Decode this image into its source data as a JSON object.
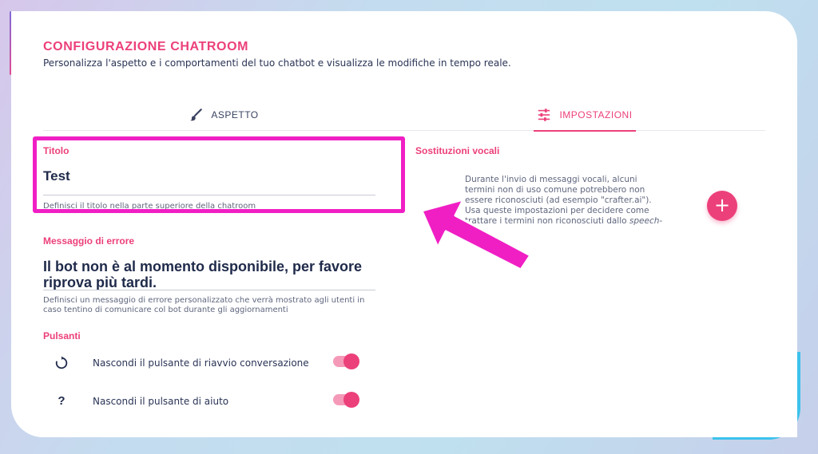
{
  "header": {
    "title": "CONFIGURAZIONE CHATROOM",
    "subtitle": "Personalizza l'aspetto e i comportamenti del tuo chatbot e visualizza le modifiche in tempo reale."
  },
  "tabs": [
    {
      "label": "ASPETTO",
      "icon": "brush-icon",
      "active": false
    },
    {
      "label": "IMPOSTAZIONI",
      "icon": "sliders-icon",
      "active": true
    }
  ],
  "titolo": {
    "label": "Titolo",
    "value": "Test",
    "help": "Definisci il titolo nella parte superiore della chatroom"
  },
  "errore": {
    "label": "Messaggio di errore",
    "value_line1": "Il bot non è al momento disponibile, per favore",
    "value_line2": "riprova più tardi.",
    "help_line1": "Definisci un messaggio di errore personalizzato che verrà mostrato agli utenti in",
    "help_line2": "caso tentino di comunicare col bot durante gli aggiornamenti"
  },
  "pulsanti": {
    "label": "Pulsanti",
    "items": [
      {
        "label": "Nascondi il pulsante di riavvio conversazione",
        "icon": "restart-icon",
        "enabled": true
      },
      {
        "label": "Nascondi il pulsante di aiuto",
        "icon": "question-icon",
        "enabled": true
      }
    ]
  },
  "sostituzioni": {
    "label": "Sostituzioni vocali",
    "line1": "Durante l'invio di messaggi vocali, alcuni",
    "line2": "termini non di uso comune potrebbero non",
    "line3": "essere riconosciuti (ad esempio \"crafter.ai\").",
    "line4": "Usa queste impostazioni per decidere come",
    "line5": "trattare i termini non riconosciuti dallo",
    "line5_italic": "speech-",
    "add_button": "+"
  },
  "colors": {
    "accent": "#ec407a",
    "highlight": "#f01fc4",
    "text_dark": "#1f2a4a"
  }
}
